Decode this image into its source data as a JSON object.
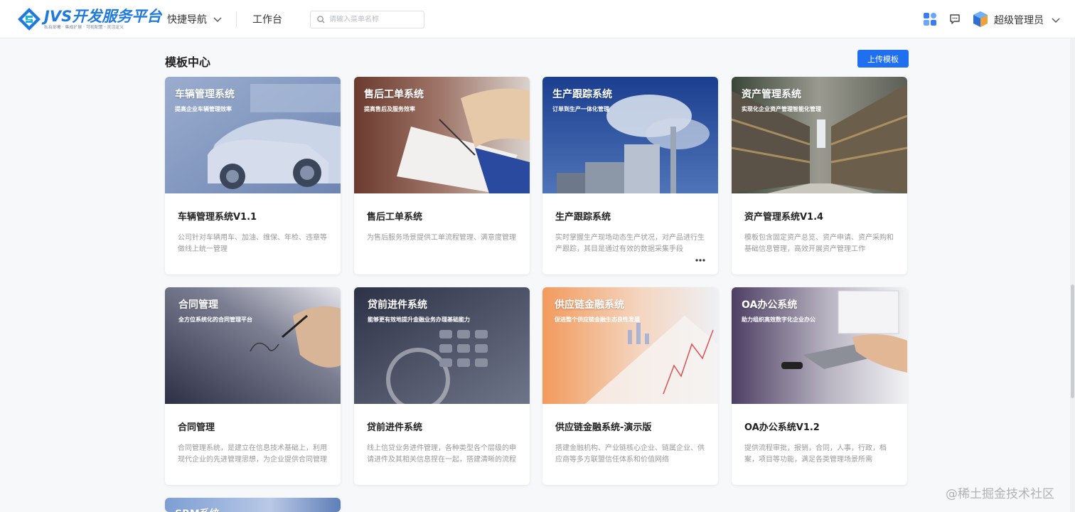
{
  "header": {
    "logo_title": "JVS开发服务平台",
    "logo_subtitle": "私有部署 · 集成扩展 · 可视配置 · 灵活定义",
    "nav_quick": "快捷导航",
    "nav_workbench": "工作台",
    "search_placeholder": "请输入菜单名称",
    "user_name": "超级管理员",
    "brand_color": "#1f6ff0"
  },
  "page": {
    "title": "模板中心",
    "upload_button": "上传模板"
  },
  "cards": [
    {
      "banner_title": "车辆管理系统",
      "banner_subtitle": "提高企业车辆管理效率",
      "name": "车辆管理系统V1.1",
      "desc": "公司针对车辆用车、加油、维保、年检、违章等做线上统一管理",
      "theme": "#8fa6c9"
    },
    {
      "banner_title": "售后工单系统",
      "banner_subtitle": "提高售后及服务效率",
      "name": "售后工单系统",
      "desc": "为售后服务场景提供工单流程管理、满意度管理",
      "theme": "#7a4a3c"
    },
    {
      "banner_title": "生产跟踪系统",
      "banner_subtitle": "订单到生产一体化管理",
      "name": "生产跟踪系统",
      "desc": "实时掌握生产现场动态生产状况，对产品进行生产跟踪，其目是通过有效的数据采集手段",
      "theme": "#1e3f8a"
    },
    {
      "banner_title": "资产管理系统",
      "banner_subtitle": "实现化企业资产管理智能化管理",
      "name": "资产管理系统V1.4",
      "desc": "模板包含固定资产总览、资产申请、资产采购和基础信息管理，高效开展资产管理工作",
      "theme": "#3d4a3a"
    },
    {
      "banner_title": "合同管理",
      "banner_subtitle": "全方位系统化的合同管理平台",
      "name": "合同管理",
      "desc": "合同管理系统，是建立在信息技术基础上，利用现代企业的先进管理思想，为企业提供合同管理",
      "theme": "#3a3d52"
    },
    {
      "banner_title": "贷前进件系统",
      "banner_subtitle": "能够更有效地提升金融业务办理基础能力",
      "name": "贷前进件系统",
      "desc": "线上信贷业务进件管理，各种类型各个层级的申请进件及其相关信息捏在一起，搭建清晰的流程",
      "theme": "#2f3448"
    },
    {
      "banner_title": "供应链金融系统",
      "banner_subtitle": "促进整个供应链金融生态良性发展",
      "name": "供应链金融系统-演示版",
      "desc": "搭建金融机构、产业链核心企业、链属企业、供应商等多方联盟信任体系和价值网络",
      "theme": "#f0a56a"
    },
    {
      "banner_title": "OA办公系统",
      "banner_subtitle": "助力组织高效数字化企业办公",
      "name": "OA办公系统V1.2",
      "desc": "提供流程审批，报销，合同，人事，行政，档案，项目等功能，满足各类管理场景所需",
      "theme": "#5a4a6e"
    },
    {
      "banner_title": "SRM系统",
      "theme": "#7f9fd0"
    }
  ],
  "watermark": "@稀土掘金技术社区"
}
